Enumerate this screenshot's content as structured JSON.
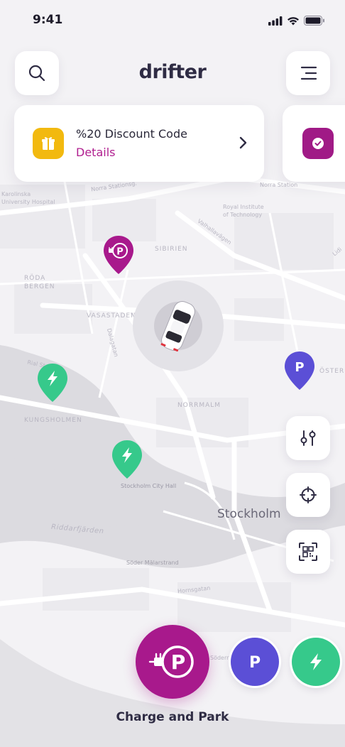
{
  "status_bar": {
    "time": "9:41"
  },
  "header": {
    "logo": "drifter"
  },
  "promo_cards": [
    {
      "title": "%20 Discount Code",
      "link": "Details"
    }
  ],
  "map": {
    "labels": {
      "karolinska": "Karolinska\nUniversity Hospital",
      "royal": "Royal Institute\nof Technology",
      "norra_stationsg": "Norra Stationsg.",
      "norra_stationsg2": "Norra Station",
      "valhallavagen": "Valhallavägen",
      "sibirien": "SIBIRIEN",
      "roda_bergen": "RÖDA\nBERGEN",
      "vasastaden": "VASASTADEN",
      "dalagatan": "Dalagatan",
      "norrmalm": "NORRMALM",
      "kungsholmen": "KUNGSHOLMEN",
      "ostermalm": "ÖSTER",
      "stockholm_city_hall": "Stockholm City Hall",
      "stockholm": "Stockholm",
      "riddarfjarden": "Riddarfjärden",
      "soder_malarstrand": "Söder Mälarstrand",
      "hornsgatan": "Hornsgatan",
      "lidingo": "Lidi",
      "sodern": "Södern",
      "rialstrand": "Rial Strand"
    }
  },
  "bottom": {
    "selected_label": "Charge and Park"
  },
  "colors": {
    "magenta": "#a8198c",
    "purple": "#5b4fd6",
    "green": "#36c98b",
    "yellow": "#f2b90f"
  }
}
